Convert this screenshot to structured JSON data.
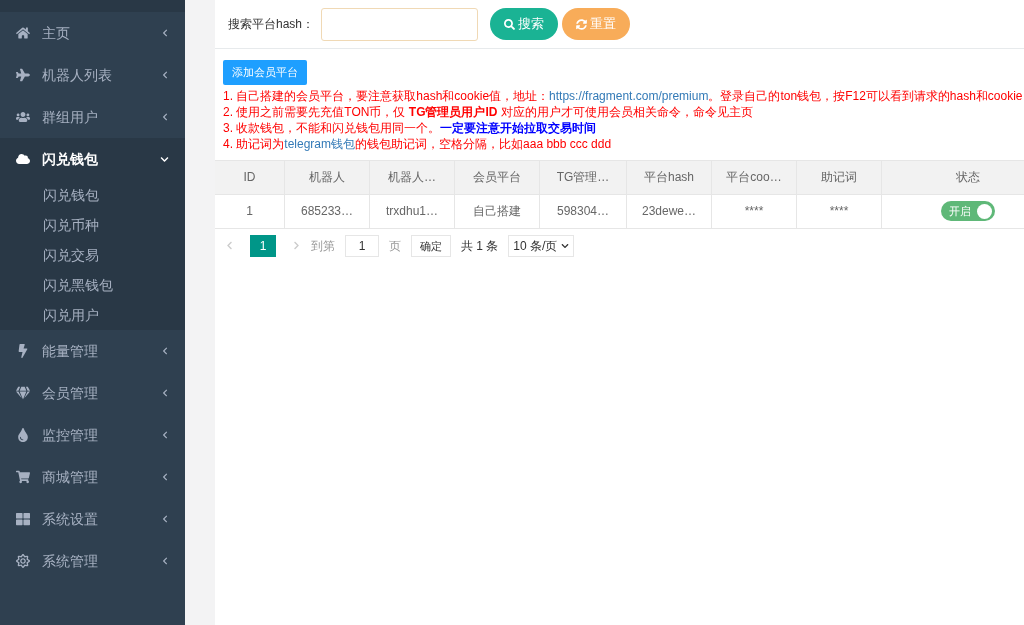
{
  "sidebar": {
    "items": [
      {
        "label": "主页",
        "expanded": false
      },
      {
        "label": "机器人列表",
        "expanded": false
      },
      {
        "label": "群组用户",
        "expanded": false
      },
      {
        "label": "闪兑钱包",
        "expanded": true,
        "children": [
          {
            "label": "闪兑钱包"
          },
          {
            "label": "闪兑币种"
          },
          {
            "label": "闪兑交易"
          },
          {
            "label": "闪兑黑钱包"
          },
          {
            "label": "闪兑用户"
          }
        ]
      },
      {
        "label": "能量管理",
        "expanded": false
      },
      {
        "label": "会员管理",
        "expanded": false
      },
      {
        "label": "监控管理",
        "expanded": false
      },
      {
        "label": "商城管理",
        "expanded": false
      },
      {
        "label": "系统设置",
        "expanded": false
      },
      {
        "label": "系统管理",
        "expanded": false
      }
    ]
  },
  "search": {
    "label": "搜索平台hash：",
    "search_button": "搜索",
    "reset_button": "重置"
  },
  "add_button": "添加会员平台",
  "notes": [
    [
      {
        "kind": "plain",
        "text": "1. 自己搭建的会员平台，要注意获取hash和cookie值，地址："
      },
      {
        "kind": "link",
        "text": "https://fragment.com/premium"
      },
      {
        "kind": "plain",
        "text": "。登录自己的ton钱包，按F12可以看到请求的hash和cookie"
      }
    ],
    [
      {
        "kind": "plain",
        "text": "2. 使用之前需要先充值TON币，仅 "
      },
      {
        "kind": "bold",
        "text": "TG管理员用户ID"
      },
      {
        "kind": "plain",
        "text": " 对应的用户才可使用会员相关命令，命令见主页"
      }
    ],
    [
      {
        "kind": "plain",
        "text": "3. 收款钱包，不能和闪兑钱包用同一个。"
      },
      {
        "kind": "emph",
        "text": "一定要注意开始拉取交易时间"
      }
    ],
    [
      {
        "kind": "plain",
        "text": "4. 助记词为"
      },
      {
        "kind": "link",
        "text": "telegram钱包"
      },
      {
        "kind": "plain",
        "text": "的钱包助记词，空格分隔，比如aaa bbb ccc ddd"
      }
    ]
  ],
  "table": {
    "columns": [
      "ID",
      "机器人",
      "机器人…",
      "会员平台",
      "TG管理…",
      "平台hash",
      "平台coo…",
      "助记词",
      "状态"
    ],
    "rows": [
      {
        "cells": [
          "1",
          "685233…",
          "trxdhu1…",
          "自己搭建",
          "598304…",
          "23dewe…",
          "****",
          "****"
        ],
        "status": {
          "label": "开启",
          "on": true
        }
      }
    ]
  },
  "pagination": {
    "pages": [
      {
        "label": "1",
        "selected": true
      }
    ],
    "goto_label": "到第",
    "goto_value": "1",
    "page_unit": "页",
    "confirm": "确定",
    "total": "共 1 条",
    "page_size": "10 条/页"
  }
}
